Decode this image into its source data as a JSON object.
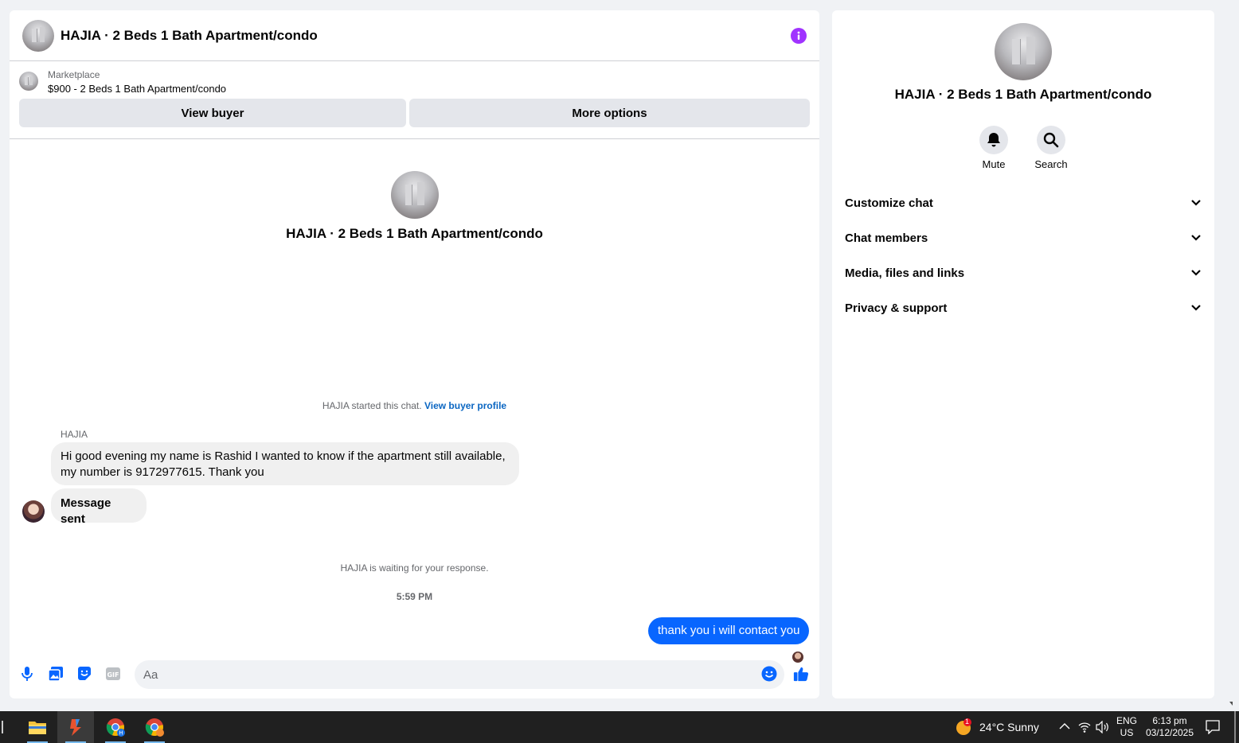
{
  "chat": {
    "title": "HAJIA · 2 Beds 1 Bath Apartment/condo",
    "listing_source": "Marketplace",
    "listing_title": "$900 - 2 Beds 1 Bath Apartment/condo",
    "view_buyer_label": "View buyer",
    "more_options_label": "More options",
    "intro_name": "HAJIA · 2 Beds 1 Bath Apartment/condo",
    "started_text": "HAJIA started this chat.",
    "view_profile_link": "View buyer profile",
    "sender_name": "HAJIA",
    "incoming_message_1": "Hi good evening my name is Rashid I wanted to know if the apartment still available,",
    "incoming_message_1b": "my number is 9172977615. Thank you",
    "incoming_message_2": "Message sent",
    "waiting_text": "HAJIA is waiting for your response.",
    "timestamp": "5:59 PM",
    "outgoing_message": "thank you i will contact you",
    "input_placeholder": "Aa"
  },
  "info": {
    "name": "HAJIA · 2 Beds 1 Bath Apartment/condo",
    "mute_label": "Mute",
    "search_label": "Search",
    "sections": [
      "Customize chat",
      "Chat members",
      "Media, files and links",
      "Privacy & support"
    ]
  },
  "taskbar": {
    "weather_badge": "1",
    "weather_text": "24°C  Sunny",
    "lang_line1": "ENG",
    "lang_line2": "US",
    "time": "6:13 pm",
    "date": "03/12/2025"
  },
  "colors": {
    "accent_blue": "#0866ff",
    "info_purple": "#a033ff",
    "link_blue": "#0a66c2"
  }
}
